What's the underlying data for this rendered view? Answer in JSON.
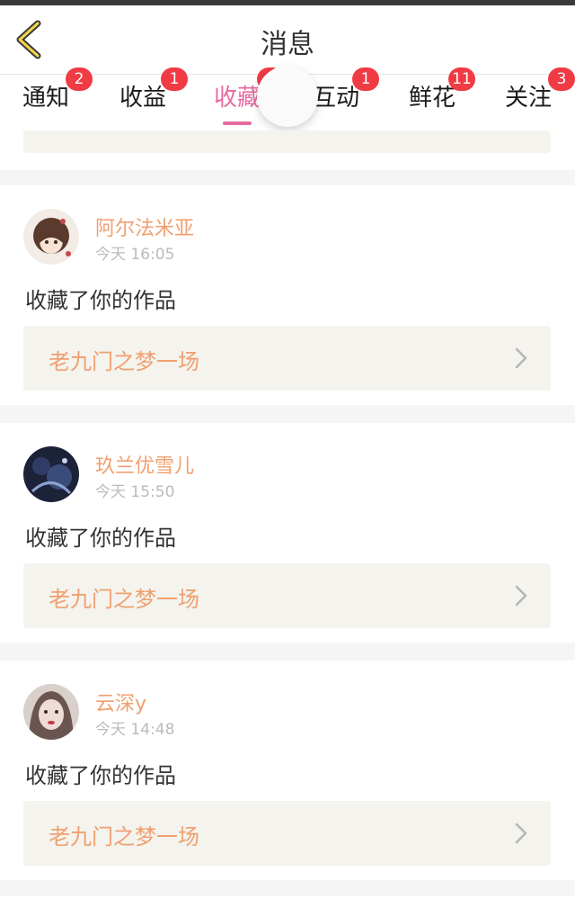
{
  "header": {
    "title": "消息"
  },
  "tabs": [
    {
      "label": "通知",
      "badge": "2"
    },
    {
      "label": "收益",
      "badge": "1"
    },
    {
      "label": "收藏",
      "badge": "",
      "active": true
    },
    {
      "label": "互动",
      "badge": "1"
    },
    {
      "label": "鲜花",
      "badge": "11"
    },
    {
      "label": "关注",
      "badge": "3"
    }
  ],
  "messages": [
    {
      "user": "阿尔法米亚",
      "time": "今天 16:05",
      "action": "收藏了你的作品",
      "work": "老九门之梦一场"
    },
    {
      "user": "玖兰优雪儿",
      "time": "今天 15:50",
      "action": "收藏了你的作品",
      "work": "老九门之梦一场"
    },
    {
      "user": "云深y",
      "time": "今天 14:48",
      "action": "收藏了你的作品",
      "work": "老九门之梦一场"
    }
  ],
  "colors": {
    "accent": "#e86aa0",
    "name": "#f0a070",
    "badge": "#f03a44",
    "work_bg": "#f4f3ed"
  }
}
